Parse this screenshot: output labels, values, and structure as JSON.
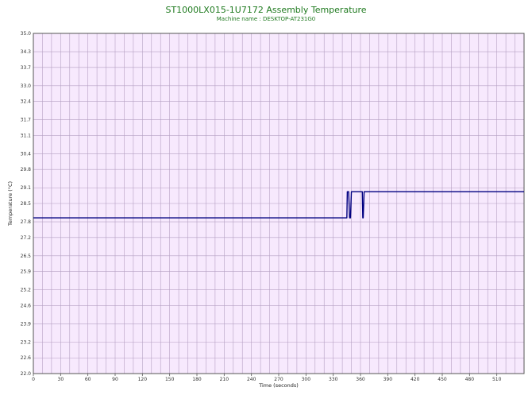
{
  "chart_data": {
    "type": "line",
    "title": "ST1000LX015-1U7172 Assembly Temperature",
    "subtitle": "Machine name : DESKTOP-AT231G0",
    "xlabel": "Time (seconds)",
    "ylabel": "Temperature (°C)",
    "xlim": [
      0,
      540
    ],
    "ylim": [
      22.0,
      35.0
    ],
    "x_ticks": [
      0,
      30,
      60,
      90,
      120,
      150,
      180,
      210,
      240,
      270,
      300,
      330,
      360,
      390,
      420,
      450,
      480,
      510
    ],
    "y_ticks": [
      "22.0",
      "22.6",
      "23.2",
      "23.9",
      "24.6",
      "25.2",
      "25.9",
      "26.5",
      "27.2",
      "27.8",
      "28.5",
      "29.1",
      "29.8",
      "30.4",
      "31.1",
      "31.7",
      "32.4",
      "33.0",
      "33.7",
      "34.3",
      "35.0"
    ],
    "grid": true,
    "series": [
      {
        "color": "#000080",
        "x": [
          0,
          345,
          345.5,
          347,
          348,
          349,
          350,
          351,
          362,
          362.5,
          363,
          364,
          364.5,
          540
        ],
        "y": [
          27.95,
          27.95,
          28.95,
          28.95,
          27.95,
          27.95,
          28.95,
          28.95,
          28.95,
          27.95,
          27.95,
          28.95,
          28.95,
          28.95
        ]
      }
    ]
  },
  "colors": {
    "plot_background": "#f7e9fd",
    "grid": "#b5a0c3",
    "title": "#1f7a1f",
    "series": "#000080"
  }
}
